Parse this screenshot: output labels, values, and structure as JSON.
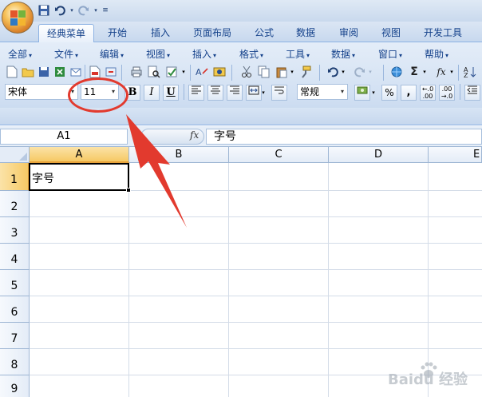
{
  "quick_access": {
    "icons": [
      "save-icon",
      "undo-icon",
      "redo-icon",
      "customize-icon"
    ]
  },
  "tabs": [
    {
      "label": "经典菜单",
      "active": true
    },
    {
      "label": "开始",
      "active": false
    },
    {
      "label": "插入",
      "active": false
    },
    {
      "label": "页面布局",
      "active": false
    },
    {
      "label": "公式",
      "active": false
    },
    {
      "label": "数据",
      "active": false
    },
    {
      "label": "审阅",
      "active": false
    },
    {
      "label": "视图",
      "active": false
    },
    {
      "label": "开发工具",
      "active": false
    }
  ],
  "menus": [
    {
      "label": "全部"
    },
    {
      "label": "文件"
    },
    {
      "label": "编辑"
    },
    {
      "label": "视图"
    },
    {
      "label": "插入"
    },
    {
      "label": "格式"
    },
    {
      "label": "工具"
    },
    {
      "label": "数据"
    },
    {
      "label": "窗口"
    },
    {
      "label": "帮助"
    }
  ],
  "toolbar": {
    "font_name": "宋体",
    "font_size": "11",
    "bold_label": "B",
    "italic_label": "I",
    "underline_label": "U",
    "number_format": "常规",
    "percent_label": "%",
    "comma_label": ",",
    "sum_label": "Σ",
    "fx_label": "fx"
  },
  "formula_bar": {
    "name_box": "A1",
    "fx_label": "fx",
    "content": "字号"
  },
  "grid": {
    "columns": [
      "A",
      "B",
      "C",
      "D",
      "E"
    ],
    "rows": [
      "1",
      "2",
      "3",
      "4",
      "5",
      "6",
      "7",
      "8",
      "9"
    ],
    "selected_column": "A",
    "selected_row": "1",
    "cell_a1": "字号"
  },
  "watermark": {
    "text": "Baidu 经验"
  },
  "colors": {
    "accent": "#15428b",
    "annotation": "#e23a2e",
    "selected_header": "#f6c965"
  }
}
